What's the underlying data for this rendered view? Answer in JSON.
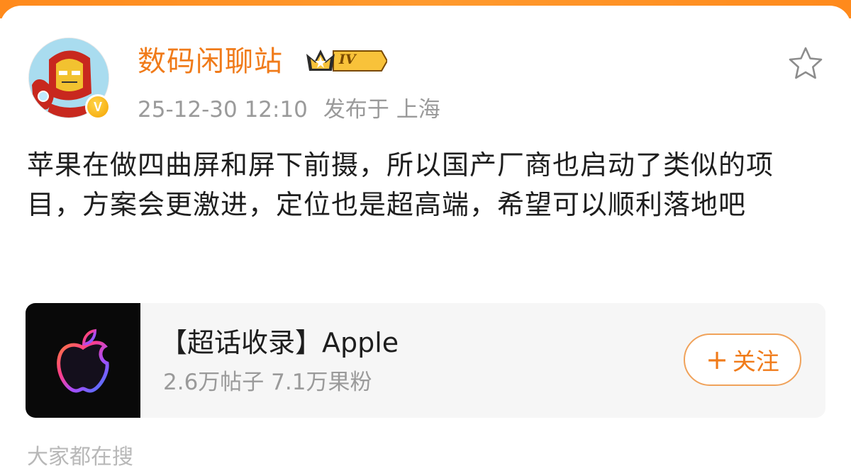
{
  "post": {
    "author": {
      "name": "数码闲聊站",
      "level_badge": "IV",
      "verified_badge": "V"
    },
    "timestamp": "25-12-30 12:10",
    "location": "发布于 上海",
    "text": "苹果在做四曲屏和屏下前摄，所以国产厂商也启动了类似的项目，方案会更激进，定位也是超高端，希望可以顺利落地吧"
  },
  "topic_card": {
    "title": "【超话收录】Apple",
    "stats": "2.6万帖子 7.1万果粉",
    "follow_plus": "+",
    "follow_label": "关注"
  },
  "footer": {
    "partial_label": "大家都在搜"
  },
  "colors": {
    "accent_orange": "#f07b1a",
    "top_strip": "#ff8a1c",
    "meta_gray": "#9a9a9a",
    "card_bg": "#f6f6f6"
  },
  "icons": {
    "favorite": "star-icon",
    "level": "crown-icon",
    "verified": "verified-badge-icon",
    "topic_logo": "apple-logo-icon"
  }
}
